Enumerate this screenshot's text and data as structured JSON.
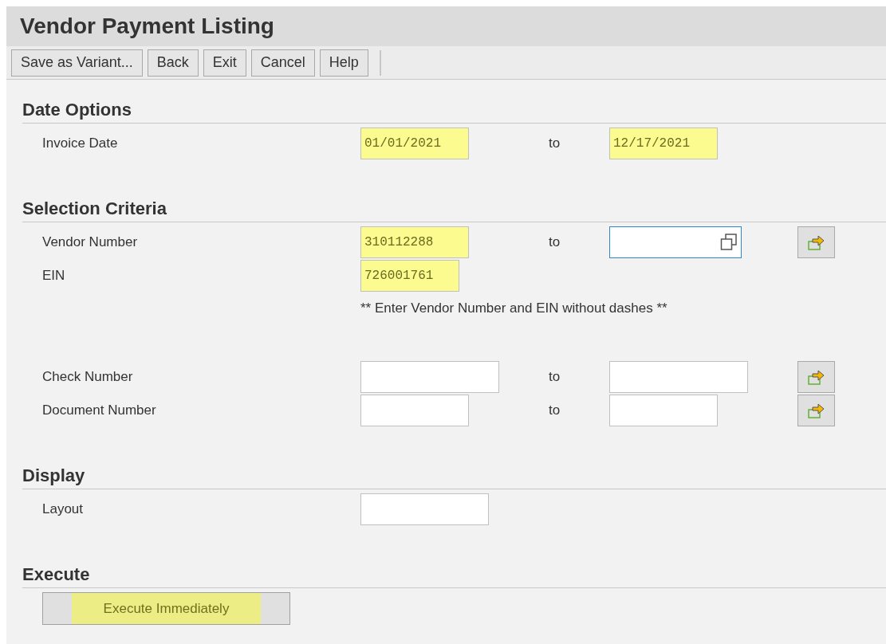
{
  "title": "Vendor Payment Listing",
  "toolbar": [
    "Save as Variant...",
    "Back",
    "Exit",
    "Cancel",
    "Help"
  ],
  "sections": [
    {
      "heading": "Date Options",
      "rows": [
        {
          "kind": "range",
          "label": "Invoice Date",
          "from": {
            "value": "01/01/2021",
            "highlighted": true,
            "focused": false
          },
          "separator": "to",
          "to": {
            "value": "12/17/2021",
            "highlighted": true,
            "focused": false
          },
          "multi_select": false
        }
      ]
    },
    {
      "heading": "Selection Criteria",
      "rows": [
        {
          "kind": "range",
          "label": "Vendor Number",
          "from": {
            "value": "310112288",
            "highlighted": true,
            "focused": false
          },
          "separator": "to",
          "to": {
            "highlighted": false,
            "focused": true
          },
          "multi_select": true
        },
        {
          "kind": "single",
          "label": "EIN",
          "from": {
            "value": "726001761",
            "highlighted": true,
            "focused": false
          }
        },
        {
          "kind": "note",
          "text": "** Enter Vendor Number and EIN without dashes **"
        },
        {
          "kind": "range",
          "label": "Check Number",
          "from": {
            "highlighted": false,
            "focused": false
          },
          "separator": "to",
          "to": {
            "highlighted": false,
            "focused": false
          },
          "multi_select": true
        },
        {
          "kind": "range",
          "label": "Document Number",
          "from": {
            "highlighted": false,
            "focused": false
          },
          "separator": "to",
          "to": {
            "highlighted": false,
            "focused": false
          },
          "multi_select": true
        }
      ]
    },
    {
      "heading": "Display",
      "rows": [
        {
          "kind": "single",
          "label": "Layout",
          "from": {
            "highlighted": false,
            "focused": false
          }
        }
      ]
    }
  ],
  "execute": {
    "heading": "Execute",
    "button": {
      "label": "Execute Immediately",
      "highlighted": true
    }
  }
}
